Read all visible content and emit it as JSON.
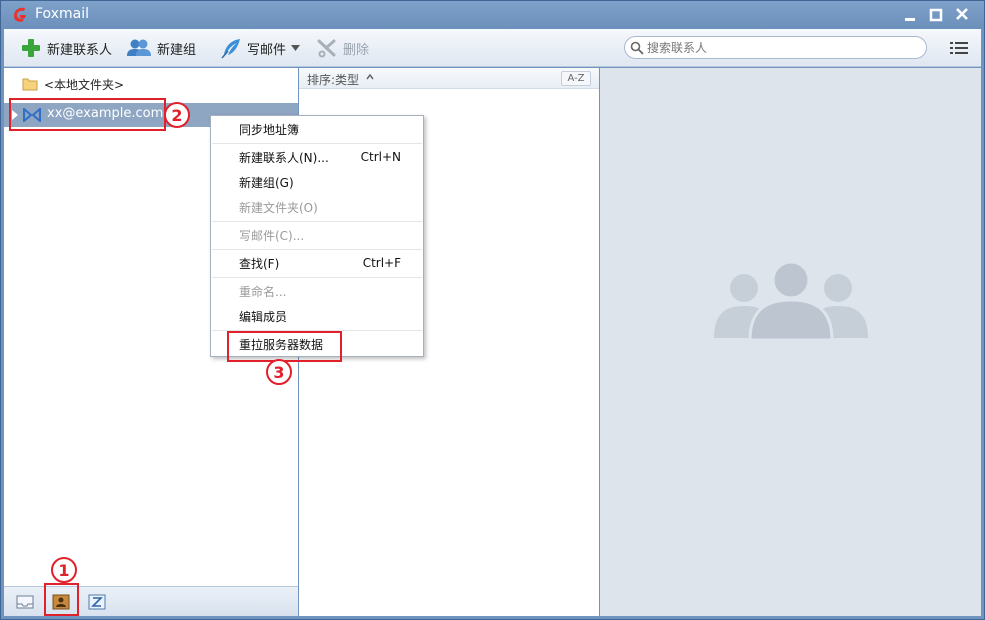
{
  "window": {
    "title": "Foxmail"
  },
  "toolbar": {
    "new_contact": "新建联系人",
    "new_group": "新建组",
    "write_mail": "写邮件",
    "delete": "删除",
    "search_placeholder": "搜索联系人"
  },
  "tree": {
    "local_folder": "<本地文件夹>",
    "account": "xx@example.com"
  },
  "list": {
    "sort_label": "排序:类型",
    "az_label": "A-Z"
  },
  "context_menu": {
    "items": [
      {
        "label": "同步地址簿",
        "shortcut": ""
      },
      {
        "label": "新建联系人(N)...",
        "shortcut": "Ctrl+N"
      },
      {
        "label": "新建组(G)",
        "shortcut": ""
      },
      {
        "label": "新建文件夹(O)",
        "shortcut": ""
      },
      {
        "label": "写邮件(C)...",
        "shortcut": ""
      },
      {
        "label": "查找(F)",
        "shortcut": "Ctrl+F"
      },
      {
        "label": "重命名...",
        "shortcut": ""
      },
      {
        "label": "编辑成员",
        "shortcut": ""
      },
      {
        "label": "重拉服务器数据",
        "shortcut": ""
      }
    ]
  },
  "annotations": {
    "badge1": "1",
    "badge2": "2",
    "badge3": "3",
    "color": "#e0202a"
  },
  "colors": {
    "titlebar": "#6f94bf",
    "selection": "#8ea6c2",
    "right_panel": "#dde4ec"
  }
}
